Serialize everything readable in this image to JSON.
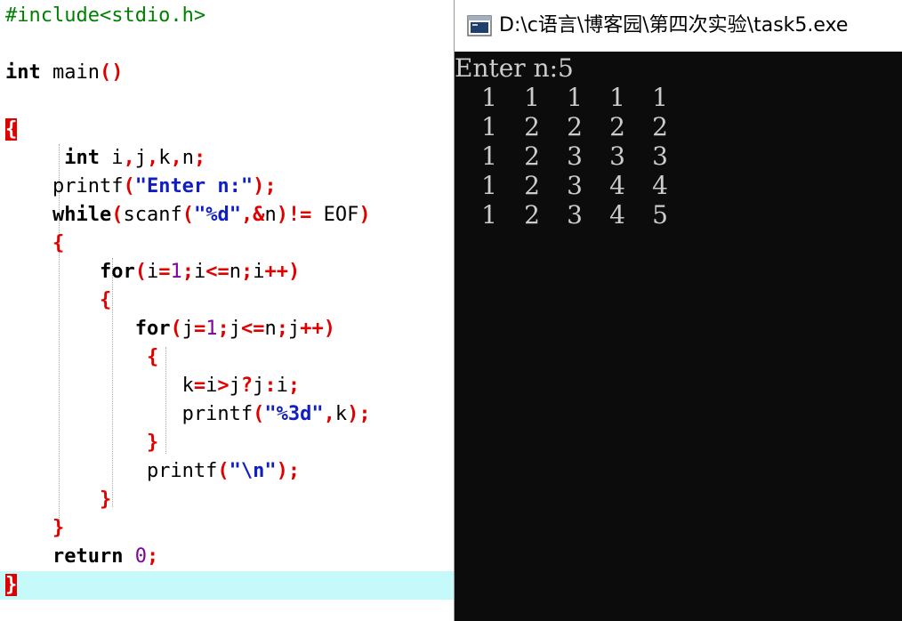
{
  "window": {
    "title": "D:\\c语言\\博客园\\第四次实验\\task5.exe"
  },
  "editor": {
    "lines": [
      {
        "parts": [
          [
            "pp",
            "#include<stdio.h>"
          ]
        ]
      },
      {
        "parts": []
      },
      {
        "parts": [
          [
            "kw",
            "int"
          ],
          [
            "t",
            " main"
          ],
          [
            "op",
            "()"
          ]
        ]
      },
      {
        "parts": []
      },
      {
        "parts": [
          [
            "bracebox",
            "{"
          ]
        ]
      },
      {
        "parts": [
          [
            "t",
            "     "
          ],
          [
            "kw",
            "int"
          ],
          [
            "t",
            " i"
          ],
          [
            "op",
            ","
          ],
          [
            "t",
            "j"
          ],
          [
            "op",
            ","
          ],
          [
            "t",
            "k"
          ],
          [
            "op",
            ","
          ],
          [
            "t",
            "n"
          ],
          [
            "op",
            ";"
          ]
        ]
      },
      {
        "parts": [
          [
            "t",
            "    printf"
          ],
          [
            "op",
            "("
          ],
          [
            "str",
            "\"Enter n:\""
          ],
          [
            "op",
            ");"
          ]
        ]
      },
      {
        "parts": [
          [
            "t",
            "    "
          ],
          [
            "kw",
            "while"
          ],
          [
            "op",
            "("
          ],
          [
            "t",
            "scanf"
          ],
          [
            "op",
            "("
          ],
          [
            "str",
            "\"%d\""
          ],
          [
            "op",
            ",&"
          ],
          [
            "t",
            "n"
          ],
          [
            "op",
            ")!="
          ],
          [
            "t",
            " EOF"
          ],
          [
            "op",
            ")"
          ]
        ]
      },
      {
        "parts": [
          [
            "t",
            "    "
          ],
          [
            "op",
            "{"
          ]
        ]
      },
      {
        "parts": [
          [
            "t",
            "        "
          ],
          [
            "kw",
            "for"
          ],
          [
            "op",
            "("
          ],
          [
            "t",
            "i"
          ],
          [
            "op",
            "="
          ],
          [
            "num",
            "1"
          ],
          [
            "op",
            ";"
          ],
          [
            "t",
            "i"
          ],
          [
            "op",
            "<="
          ],
          [
            "t",
            "n"
          ],
          [
            "op",
            ";"
          ],
          [
            "t",
            "i"
          ],
          [
            "op",
            "++)"
          ]
        ]
      },
      {
        "parts": [
          [
            "t",
            "        "
          ],
          [
            "op",
            "{"
          ]
        ]
      },
      {
        "parts": [
          [
            "t",
            "           "
          ],
          [
            "kw",
            "for"
          ],
          [
            "op",
            "("
          ],
          [
            "t",
            "j"
          ],
          [
            "op",
            "="
          ],
          [
            "num",
            "1"
          ],
          [
            "op",
            ";"
          ],
          [
            "t",
            "j"
          ],
          [
            "op",
            "<="
          ],
          [
            "t",
            "n"
          ],
          [
            "op",
            ";"
          ],
          [
            "t",
            "j"
          ],
          [
            "op",
            "++)"
          ]
        ]
      },
      {
        "parts": [
          [
            "t",
            "            "
          ],
          [
            "op",
            "{"
          ]
        ]
      },
      {
        "parts": [
          [
            "t",
            "               k"
          ],
          [
            "op",
            "="
          ],
          [
            "t",
            "i"
          ],
          [
            "op",
            ">"
          ],
          [
            "t",
            "j"
          ],
          [
            "op",
            "?"
          ],
          [
            "t",
            "j"
          ],
          [
            "op",
            ":"
          ],
          [
            "t",
            "i"
          ],
          [
            "op",
            ";"
          ]
        ]
      },
      {
        "parts": [
          [
            "t",
            "               printf"
          ],
          [
            "op",
            "("
          ],
          [
            "str",
            "\"%3d\""
          ],
          [
            "op",
            ","
          ],
          [
            "t",
            "k"
          ],
          [
            "op",
            ");"
          ]
        ]
      },
      {
        "parts": [
          [
            "t",
            "            "
          ],
          [
            "op",
            "}"
          ]
        ]
      },
      {
        "parts": [
          [
            "t",
            "            printf"
          ],
          [
            "op",
            "("
          ],
          [
            "str",
            "\"\\n\""
          ],
          [
            "op",
            ");"
          ]
        ]
      },
      {
        "parts": [
          [
            "t",
            "        "
          ],
          [
            "op",
            "}"
          ]
        ]
      },
      {
        "parts": [
          [
            "t",
            "    "
          ],
          [
            "op",
            "}"
          ]
        ]
      },
      {
        "parts": [
          [
            "t",
            "    "
          ],
          [
            "kw",
            "return"
          ],
          [
            "t",
            " "
          ],
          [
            "num",
            "0"
          ],
          [
            "op",
            ";"
          ]
        ]
      },
      {
        "parts": [
          [
            "bracebox",
            "}"
          ]
        ]
      }
    ]
  },
  "console": {
    "prompt": "Enter n:5",
    "rows": [
      [
        "1",
        "1",
        "1",
        "1",
        "1"
      ],
      [
        "1",
        "2",
        "2",
        "2",
        "2"
      ],
      [
        "1",
        "2",
        "3",
        "3",
        "3"
      ],
      [
        "1",
        "2",
        "3",
        "4",
        "4"
      ],
      [
        "1",
        "2",
        "3",
        "4",
        "5"
      ]
    ]
  },
  "colors": {
    "editor_bg": "#ffffff",
    "current_line": "#c6fafa",
    "preprocessor": "#008000",
    "operator": "#e00000",
    "string": "#1020c0",
    "number": "#8000a0",
    "console_bg": "#0c0c0c",
    "console_text": "#cccccc"
  },
  "icons": {
    "app": "console-window-icon"
  }
}
